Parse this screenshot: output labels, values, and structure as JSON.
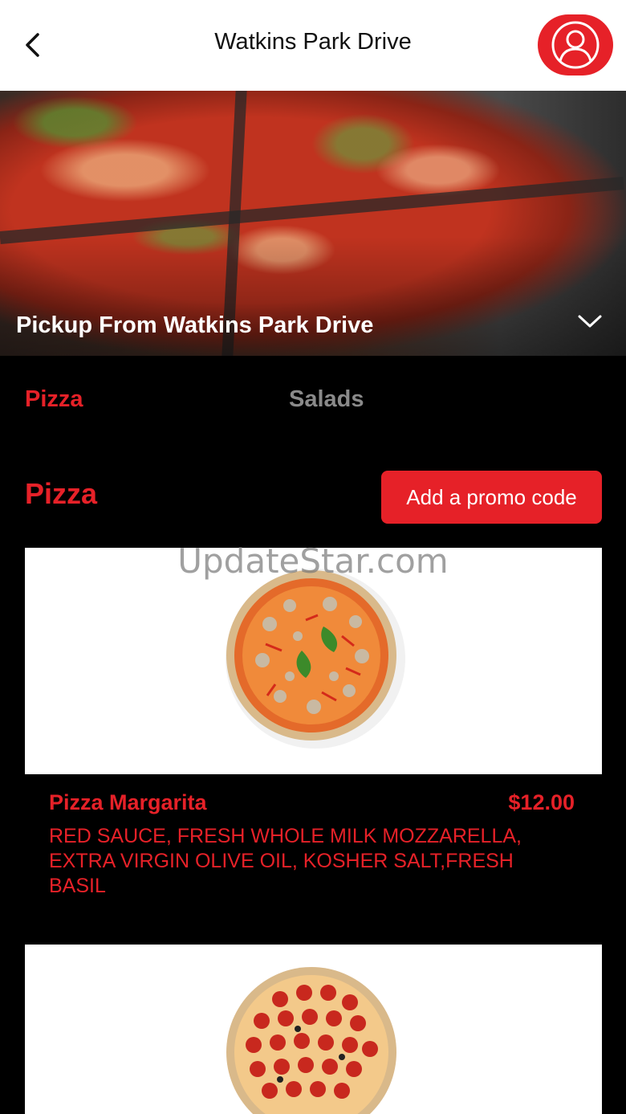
{
  "header": {
    "title": "Watkins Park Drive",
    "back_icon": "chevron-left-icon",
    "profile_icon": "user-icon"
  },
  "hero": {
    "label": "Pickup From Watkins Park Drive",
    "dropdown_icon": "chevron-down-icon"
  },
  "tabs": [
    {
      "label": "Pizza",
      "active": true
    },
    {
      "label": "Salads",
      "active": false
    }
  ],
  "section": {
    "title": "Pizza",
    "promo_button": "Add a promo code"
  },
  "menu_items": [
    {
      "name": "Pizza Margarita",
      "price": "$12.00",
      "description": "RED SAUCE, FRESH WHOLE MILK MOZZARELLA, EXTRA VIRGIN OLIVE OIL, KOSHER SALT,FRESH BASIL"
    }
  ],
  "watermark": "UpdateStar.com",
  "colors": {
    "accent": "#e62128",
    "background": "#000000",
    "tab_inactive": "#8a8a8a"
  }
}
